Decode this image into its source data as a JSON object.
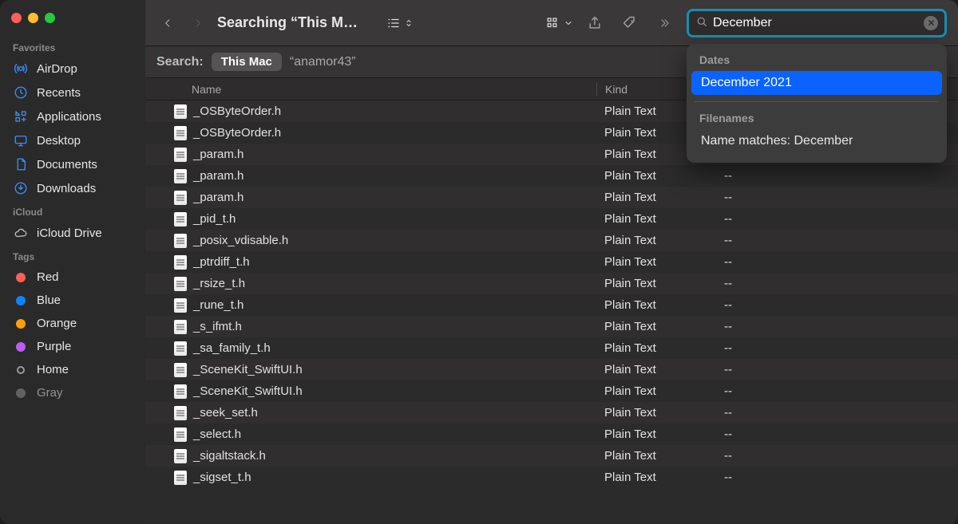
{
  "window": {
    "title": "Searching “This M…"
  },
  "sidebar": {
    "sections": {
      "favorites": {
        "label": "Favorites",
        "items": [
          {
            "label": "AirDrop"
          },
          {
            "label": "Recents"
          },
          {
            "label": "Applications"
          },
          {
            "label": "Desktop"
          },
          {
            "label": "Documents"
          },
          {
            "label": "Downloads"
          }
        ]
      },
      "icloud": {
        "label": "iCloud",
        "items": [
          {
            "label": "iCloud Drive"
          }
        ]
      },
      "tags": {
        "label": "Tags",
        "items": [
          {
            "label": "Red",
            "color": "red"
          },
          {
            "label": "Blue",
            "color": "blue"
          },
          {
            "label": "Orange",
            "color": "orange"
          },
          {
            "label": "Purple",
            "color": "purple"
          },
          {
            "label": "Home",
            "color": "home"
          },
          {
            "label": "Gray",
            "color": "gray"
          }
        ]
      }
    }
  },
  "toolbar": {
    "back_label": "Back",
    "forward_label": "Forward"
  },
  "search": {
    "value": "December",
    "suggestions": {
      "dates_label": "Dates",
      "date_items": [
        "December 2021"
      ],
      "filenames_label": "Filenames",
      "filename_items": [
        "Name matches: December"
      ]
    }
  },
  "scope": {
    "label": "Search:",
    "active": "This Mac",
    "alt": "“anamor43”"
  },
  "columns": {
    "name": "Name",
    "kind": "Kind",
    "date": ""
  },
  "files": [
    {
      "name": "_OSByteOrder.h",
      "kind": "Plain Text",
      "date": ""
    },
    {
      "name": "_OSByteOrder.h",
      "kind": "Plain Text",
      "date": ""
    },
    {
      "name": "_param.h",
      "kind": "Plain Text",
      "date": "--"
    },
    {
      "name": "_param.h",
      "kind": "Plain Text",
      "date": "--"
    },
    {
      "name": "_param.h",
      "kind": "Plain Text",
      "date": "--"
    },
    {
      "name": "_pid_t.h",
      "kind": "Plain Text",
      "date": "--"
    },
    {
      "name": "_posix_vdisable.h",
      "kind": "Plain Text",
      "date": "--"
    },
    {
      "name": "_ptrdiff_t.h",
      "kind": "Plain Text",
      "date": "--"
    },
    {
      "name": "_rsize_t.h",
      "kind": "Plain Text",
      "date": "--"
    },
    {
      "name": "_rune_t.h",
      "kind": "Plain Text",
      "date": "--"
    },
    {
      "name": "_s_ifmt.h",
      "kind": "Plain Text",
      "date": "--"
    },
    {
      "name": "_sa_family_t.h",
      "kind": "Plain Text",
      "date": "--"
    },
    {
      "name": "_SceneKit_SwiftUI.h",
      "kind": "Plain Text",
      "date": "--"
    },
    {
      "name": "_SceneKit_SwiftUI.h",
      "kind": "Plain Text",
      "date": "--"
    },
    {
      "name": "_seek_set.h",
      "kind": "Plain Text",
      "date": "--"
    },
    {
      "name": "_select.h",
      "kind": "Plain Text",
      "date": "--"
    },
    {
      "name": "_sigaltstack.h",
      "kind": "Plain Text",
      "date": "--"
    },
    {
      "name": "_sigset_t.h",
      "kind": "Plain Text",
      "date": "--"
    }
  ]
}
